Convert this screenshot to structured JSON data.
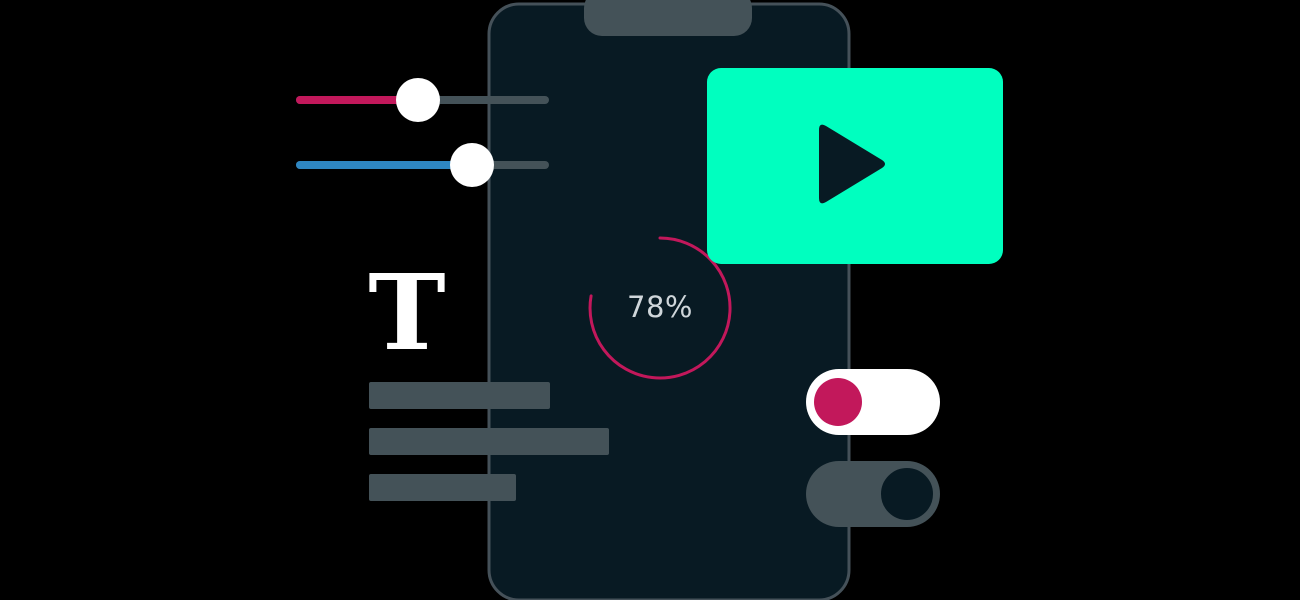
{
  "illustration": {
    "progress": {
      "label": "78%",
      "value": 0.78,
      "color": "#c2185b"
    },
    "sliders": [
      {
        "name": "slider-red",
        "value": 0.48,
        "color": "#c2185b"
      },
      {
        "name": "slider-blue",
        "value": 0.7,
        "color": "#2e86c1"
      }
    ],
    "toggles": [
      {
        "name": "toggle-on",
        "state": "on",
        "knob_color": "#c2185b"
      },
      {
        "name": "toggle-off",
        "state": "off"
      }
    ],
    "text_icon": "T",
    "text_lines": 3,
    "icons": [
      "play-icon",
      "text-icon"
    ],
    "colors": {
      "background": "#000000",
      "phone_body": "#081a23",
      "phone_border": "#455159",
      "video_card": "#00ffbf",
      "bar": "#445258",
      "accent_red": "#c2185b",
      "accent_blue": "#2e86c1",
      "white": "#ffffff"
    }
  }
}
